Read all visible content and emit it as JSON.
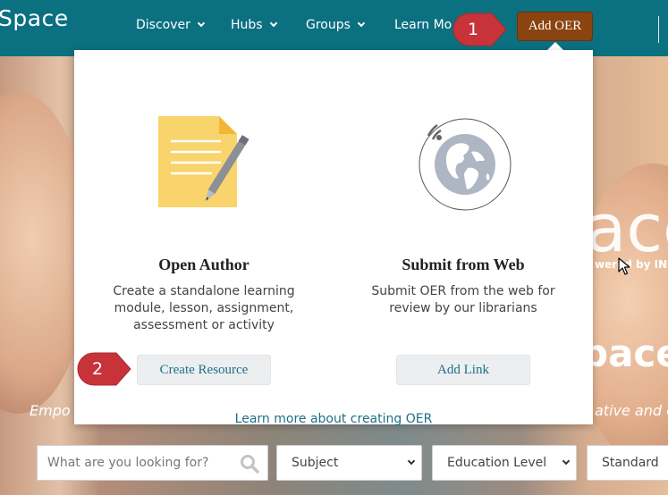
{
  "header": {
    "brand": "Space",
    "nav": [
      {
        "label": "Discover"
      },
      {
        "label": "Hubs"
      },
      {
        "label": "Groups"
      },
      {
        "label": "Learn Mo"
      }
    ],
    "add_oer_label": "Add OER"
  },
  "hero": {
    "word1": "ace",
    "powered": "wered by IN",
    "word2": "pace",
    "tag_left": "Empo",
    "tag_right": "ative and c"
  },
  "search": {
    "placeholder": "What are you looking for?",
    "subject_label": "Subject",
    "education_level_label": "Education Level",
    "standard_label": "Standard"
  },
  "panel": {
    "options": [
      {
        "title": "Open Author",
        "description": "Create a standalone learning module, lesson, assignment, assessment or activity",
        "button": "Create Resource",
        "icon": "document-pencil-icon"
      },
      {
        "title": "Submit from Web",
        "description": "Submit OER from the web for review by our librarians",
        "button": "Add Link",
        "icon": "globe-icon"
      }
    ],
    "learn_more": "Learn more about creating OER"
  },
  "callouts": [
    {
      "number": "1"
    },
    {
      "number": "2"
    }
  ],
  "colors": {
    "navbar": "#0b7080",
    "add_oer_button": "#8a4410",
    "callout": "#c8333a",
    "link": "#1e6f8a"
  }
}
